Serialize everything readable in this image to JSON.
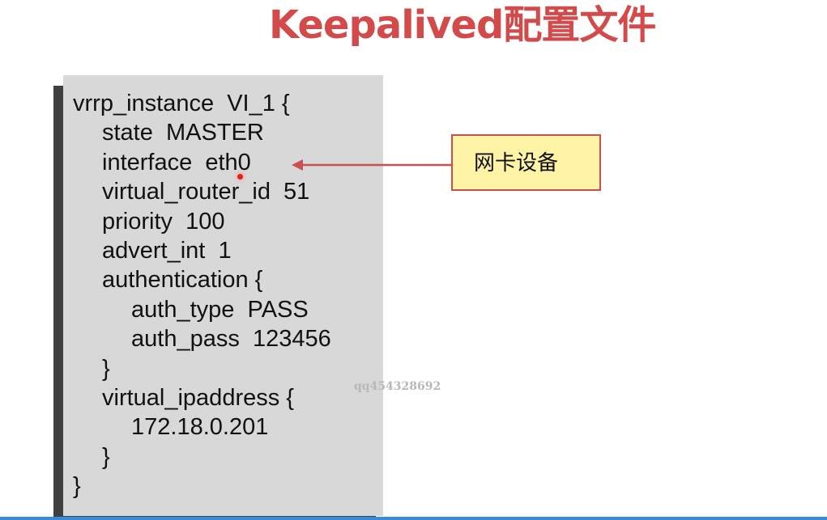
{
  "slide": {
    "title": "Keepalived配置文件",
    "callout_label": "网卡设备",
    "watermark": "qq454328692",
    "accent_color": "#d34a4b",
    "callout_fill": "#fff3a6"
  },
  "config": {
    "lines": [
      "vrrp_instance  VI_1 {",
      "state  MASTER",
      "interface  eth0",
      "virtual_router_id  51",
      "priority  100",
      "advert_int  1",
      "authentication {",
      "auth_type  PASS",
      "auth_pass  123456",
      "}",
      "virtual_ipaddress {",
      "172.18.0.201",
      "}",
      "}"
    ]
  }
}
